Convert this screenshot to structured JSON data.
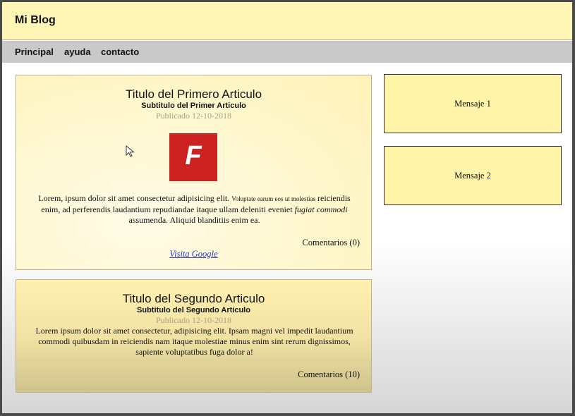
{
  "header": {
    "brand": "Mi Blog"
  },
  "nav": {
    "items": [
      "Principal",
      "ayuda",
      "contacto"
    ]
  },
  "articles": [
    {
      "title": "Titulo del Primero Articulo",
      "subtitle": "Subtitulo del Primer Articulo",
      "date": "Publicado 12-10-2018",
      "logo_letter": "F",
      "body": {
        "part1": "Lorem, ipsum dolor sit amet consectetur adipisicing elit.",
        "part2_small": "Voluptate earum eos ut molestias",
        "part3": "reiciendis enim, ad perferendis laudantium repudiandae itaque ullam deleniti eveniet",
        "part4_italic": "fugiat commodi",
        "part5": "assumenda. Aliquid blanditiis enim ea."
      },
      "comments": "Comentarios (0)",
      "link": "Visita Google"
    },
    {
      "title": "Titulo del Segundo Articulo",
      "subtitle": "Subtitulo del Segundo Articulo",
      "date": "Publicado 12-10-2018",
      "body": "Lorem ipsum dolor sit amet consectetur, adipisicing elit. Ipsam magni vel impedit laudantium commodi quibusdam in reiciendis nam itaque molestiae minus enim sint rerum dignissimos, sapiente voluptatibus fuga dolor a!",
      "comments": "Comentarios (10)"
    }
  ],
  "sidebar": {
    "messages": [
      "Mensaje 1",
      "Mensaje 2"
    ]
  },
  "colors": {
    "header_bg": "#fff5b5",
    "nav_bg": "#c9c9c9",
    "logo_red": "#cc2222",
    "link": "#2233cc"
  }
}
